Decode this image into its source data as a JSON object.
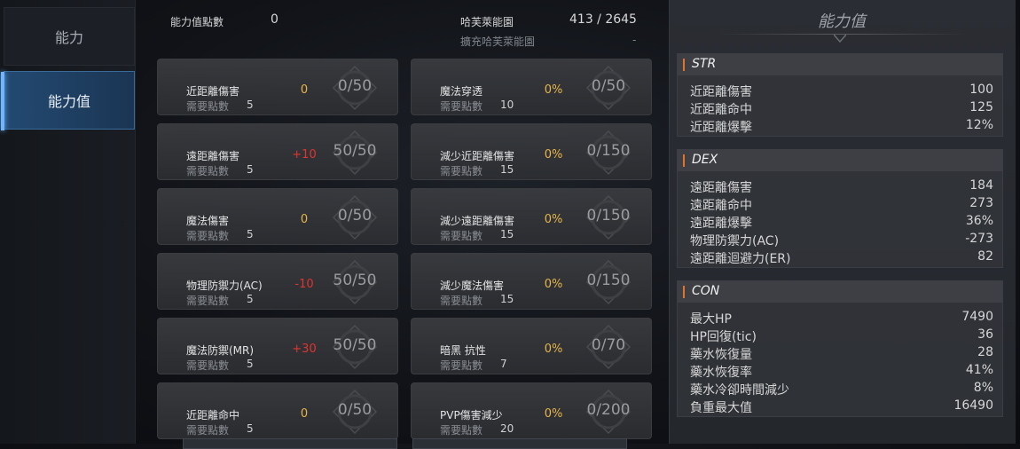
{
  "nav": {
    "items": [
      "能力",
      "能力值"
    ]
  },
  "header": {
    "points_label": "能力值點數",
    "points_value": "0",
    "herb_label": "哈芙萊能園",
    "herb_value": "413 / 2645",
    "expand_label": "擴充哈芙萊能園",
    "expand_value": "-"
  },
  "cards_left": [
    {
      "name": "近距離傷害",
      "req_label": "需要點數",
      "req": "5",
      "bonus": "0",
      "bonus_color": "#e7b54a",
      "progress": "0/50"
    },
    {
      "name": "遠距離傷害",
      "req_label": "需要點數",
      "req": "5",
      "bonus": "+10",
      "bonus_color": "#e0342e",
      "progress": "50/50"
    },
    {
      "name": "魔法傷害",
      "req_label": "需要點數",
      "req": "5",
      "bonus": "0",
      "bonus_color": "#e7b54a",
      "progress": "0/50"
    },
    {
      "name": "物理防禦力(AC)",
      "req_label": "需要點數",
      "req": "5",
      "bonus": "-10",
      "bonus_color": "#e0342e",
      "progress": "50/50"
    },
    {
      "name": "魔法防禦(MR)",
      "req_label": "需要點數",
      "req": "5",
      "bonus": "+30",
      "bonus_color": "#e0342e",
      "progress": "50/50"
    },
    {
      "name": "近距離命中",
      "req_label": "需要點數",
      "req": "5",
      "bonus": "0",
      "bonus_color": "#e7b54a",
      "progress": "0/50"
    }
  ],
  "cards_right": [
    {
      "name": "魔法穿透",
      "req_label": "需要點數",
      "req": "10",
      "bonus": "0%",
      "bonus_color": "#e7b54a",
      "progress": "0/50"
    },
    {
      "name": "減少近距離傷害",
      "req_label": "需要點數",
      "req": "15",
      "bonus": "0%",
      "bonus_color": "#e7b54a",
      "progress": "0/150"
    },
    {
      "name": "減少遠距離傷害",
      "req_label": "需要點數",
      "req": "15",
      "bonus": "0%",
      "bonus_color": "#e7b54a",
      "progress": "0/150"
    },
    {
      "name": "減少魔法傷害",
      "req_label": "需要點數",
      "req": "15",
      "bonus": "0%",
      "bonus_color": "#e7b54a",
      "progress": "0/150"
    },
    {
      "name": "暗黑 抗性",
      "req_label": "需要點數",
      "req": "7",
      "bonus": "0%",
      "bonus_color": "#e7b54a",
      "progress": "0/70"
    },
    {
      "name": "PVP傷害減少",
      "req_label": "需要點數",
      "req": "20",
      "bonus": "0%",
      "bonus_color": "#e7b54a",
      "progress": "0/200"
    }
  ],
  "panel": {
    "title": "能力值",
    "sections": [
      {
        "name": "STR",
        "rows": [
          {
            "k": "近距離傷害",
            "v": "100"
          },
          {
            "k": "近距離命中",
            "v": "125"
          },
          {
            "k": "近距離爆擊",
            "v": "12%"
          }
        ]
      },
      {
        "name": "DEX",
        "rows": [
          {
            "k": "遠距離傷害",
            "v": "184"
          },
          {
            "k": "遠距離命中",
            "v": "273"
          },
          {
            "k": "遠距離爆擊",
            "v": "36%"
          },
          {
            "k": "物理防禦力(AC)",
            "v": "-273"
          },
          {
            "k": "遠距離迴避力(ER)",
            "v": "82"
          }
        ]
      },
      {
        "name": "CON",
        "rows": [
          {
            "k": "最大HP",
            "v": "7490"
          },
          {
            "k": "HP回復(tic)",
            "v": "36"
          },
          {
            "k": "藥水恢復量",
            "v": "28"
          },
          {
            "k": "藥水恢復率",
            "v": "41%"
          },
          {
            "k": "藥水冷卻時間減少",
            "v": "8%"
          },
          {
            "k": "負重最大值",
            "v": "16490"
          }
        ]
      }
    ]
  },
  "colors": {
    "accent": "#6fb6ff",
    "positive_red": "#e0342e",
    "neutral_gold": "#e7b54a",
    "section_bar": "#e0752a"
  }
}
